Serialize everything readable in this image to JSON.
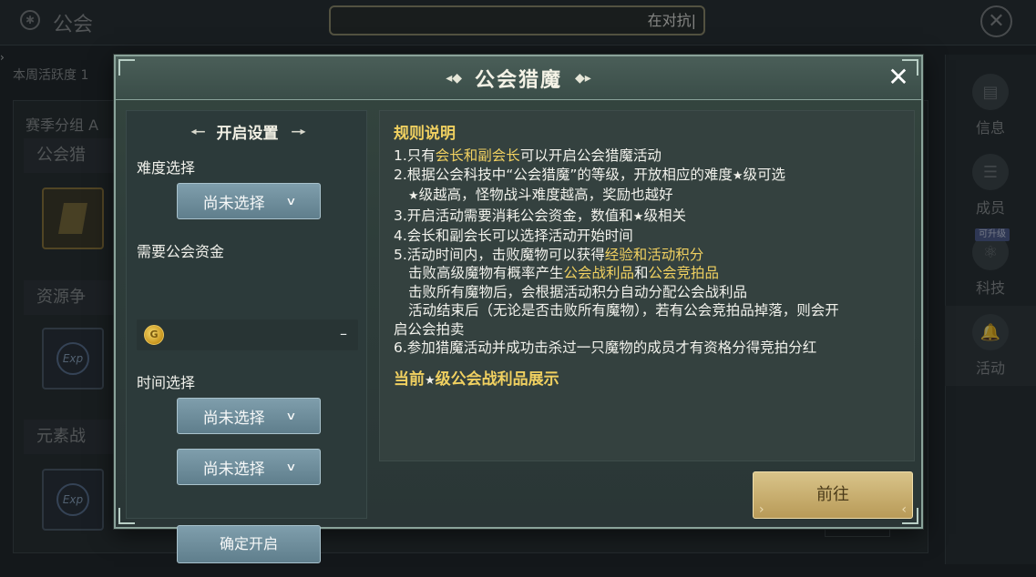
{
  "background": {
    "guild_title": "公会",
    "status_box_text": "在对抗|",
    "weekly_activity_label": "本周活跃度 1",
    "season_group_label": "赛季分组 A",
    "sections": [
      "公会猎",
      "资源争",
      "元素战"
    ],
    "exp_label": "Exp",
    "right_tabs": [
      {
        "label": "信息",
        "icon": "document-icon"
      },
      {
        "label": "成员",
        "icon": "members-icon"
      },
      {
        "label": "科技",
        "icon": "atom-icon"
      },
      {
        "label": "活动",
        "icon": "bell-icon"
      }
    ],
    "tech_badge": "可升级"
  },
  "modal": {
    "title": "公会猎魔",
    "close_label": "✕",
    "settings": {
      "header": "开启设置",
      "difficulty_label": "难度选择",
      "difficulty_value": "尚未选择",
      "funds_label": "需要公会资金",
      "funds_value": "–",
      "time_label": "时间选择",
      "time_value_1": "尚未选择",
      "time_value_2": "尚未选择",
      "confirm_label": "确定开启"
    },
    "rules": {
      "title": "规则说明",
      "line1_a": "1.只有",
      "line1_hl": "会长和副会长",
      "line1_b": "可以开启公会猎魔活动",
      "line2": "2.根据公会科技中“公会猎魔”的等级，开放相应的难度",
      "line2_b": "级可选",
      "line2_sub_a": "",
      "line2_sub_b": "级越高，怪物战斗难度越高，奖励也越好",
      "line3_a": "3.开启活动需要消耗公会资金，数值和",
      "line3_b": "级相关",
      "line4": "4.会长和副会长可以选择活动开始时间",
      "line5_a": "5.活动时间内，击败魔物可以获得",
      "line5_hl": "经验和活动积分",
      "line5_sub1_a": "击败高级魔物有概率产生",
      "line5_sub1_hl1": "公会战利品",
      "line5_sub1_b": "和",
      "line5_sub1_hl2": "公会竞拍品",
      "line5_sub2": "击败所有魔物后，会根据活动积分自动分配公会战利品",
      "line5_sub3": "活动结束后（无论是否击败所有魔物），若有公会竞拍品掉落，则会开",
      "line5_sub4": "启公会拍卖",
      "line6": "6.参加猎魔活动并成功击杀过一只魔物的成员才有资格分得竞拍分红",
      "star": "★",
      "display_title_a": "当前",
      "display_title_b": "级公会战利品展示"
    },
    "go_label": "前往"
  },
  "colors": {
    "highlight": "#f0d060",
    "panel_bg": "#34413f",
    "button_blue": "#6f8e9c",
    "button_gold": "#c8ad6e"
  }
}
